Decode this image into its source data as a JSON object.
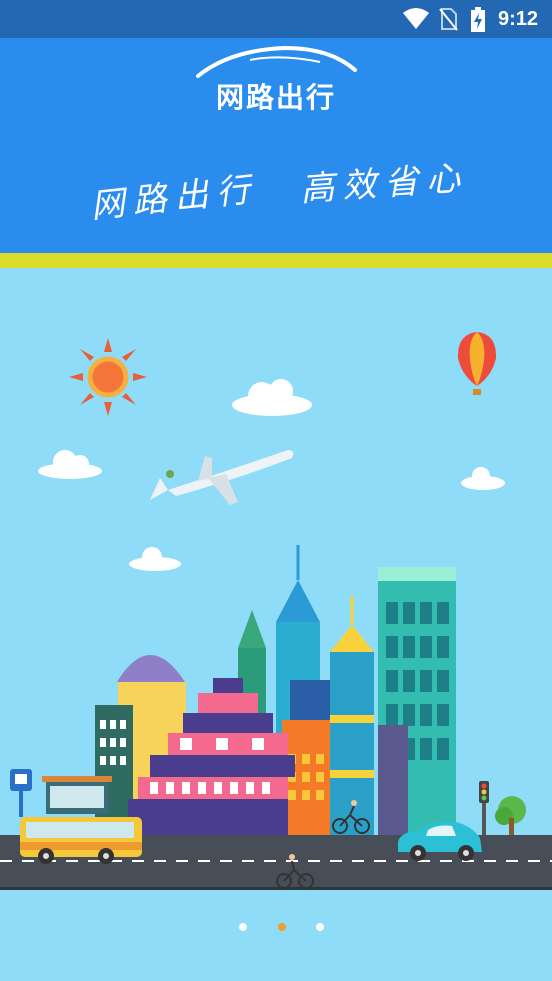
{
  "status_bar": {
    "time": "9:12",
    "icons": [
      "wifi-icon",
      "no-sim-icon",
      "battery-charging-icon"
    ]
  },
  "header": {
    "logo_text": "网路出行",
    "slogan_left": "网路出行",
    "slogan_right": "高效省心"
  },
  "pager": {
    "total": 3,
    "active_index": 1
  },
  "colors": {
    "status_bar": "#2368b3",
    "header": "#2a8cec",
    "accent_band": "#d9dc2b",
    "sky": "#8fdcf8",
    "active_dot": "#f0a028"
  }
}
